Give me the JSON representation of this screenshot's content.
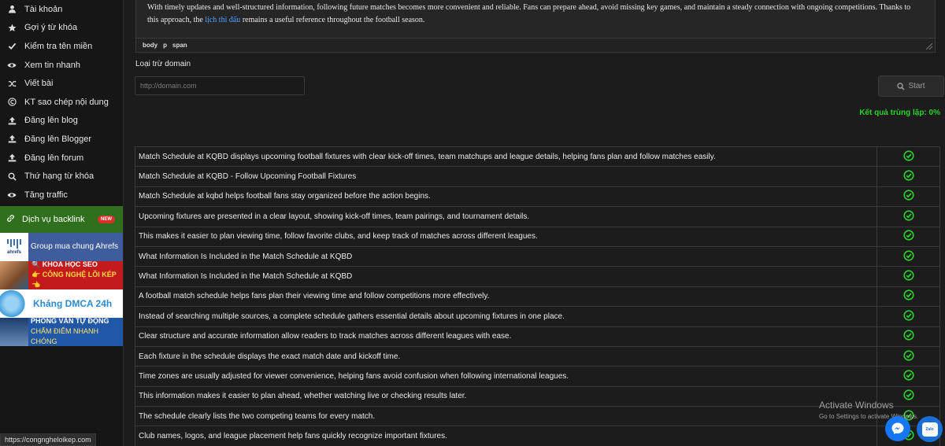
{
  "sidebar": {
    "items": [
      {
        "label": "Tài khoản",
        "icon": "user-icon"
      },
      {
        "label": "Gợi ý từ khóa",
        "icon": "star-icon"
      },
      {
        "label": "Kiểm tra tên miền",
        "icon": "check-icon"
      },
      {
        "label": "Xem tin nhanh",
        "icon": "eye-icon"
      },
      {
        "label": "Viết bài",
        "icon": "shuffle-icon"
      },
      {
        "label": "KT sao chép nội dung",
        "icon": "copyright-icon"
      },
      {
        "label": "Đăng lên blog",
        "icon": "upload-icon"
      },
      {
        "label": "Đăng lên Blogger",
        "icon": "upload-icon"
      },
      {
        "label": "Đăng lên forum",
        "icon": "upload-icon"
      },
      {
        "label": "Thứ hạng từ khóa",
        "icon": "search-icon"
      },
      {
        "label": "Tăng traffic",
        "icon": "eye-icon"
      }
    ],
    "backlink": {
      "label": "Dịch vụ backlink",
      "badge": "NEW"
    },
    "banners": {
      "ahrefs": {
        "logo": "ahrefs",
        "text": "Group mua chung Ahrefs"
      },
      "seo": {
        "line1": "🔍 KHÓA HỌC SEO",
        "line2": "👉 CÔNG NGHỆ LÕI KÉP 👈"
      },
      "dmca": {
        "text": "Kháng DMCA 24h"
      },
      "interview": {
        "line1": "PHỎNG VẤN TỰ ĐỘNG",
        "line2": "CHẤM ĐIỂM NHANH CHÓNG"
      }
    }
  },
  "status_url": "https://congngheloikep.com",
  "editor": {
    "text_before": "With timely updates and well-structured information, following future matches becomes more convenient and reliable. Fans can prepare ahead, avoid missing key games, and maintain a steady connection with ongoing competitions. Thanks to this approach, the ",
    "link_text": "lịch thi đấu",
    "text_after": " remains a useful reference throughout the football season.",
    "path": [
      "body",
      "p",
      "span"
    ]
  },
  "exclude": {
    "label": "Loại trừ domain",
    "placeholder": "http://domain.com"
  },
  "start_button": "Start",
  "result_text": "Kết quả trùng lặp: 0%",
  "colors": {
    "success": "#2bd12b",
    "link": "#4da3ff",
    "backlink_bg": "#2f6f1d"
  },
  "rows": [
    {
      "text": "Match Schedule at KQBD displays upcoming football fixtures with clear kick-off times, team matchups and league details, helping fans plan and follow matches easily.",
      "status": "ok"
    },
    {
      "text": "Match Schedule at KQBD - Follow Upcoming Football Fixtures",
      "status": "ok"
    },
    {
      "text": "Match Schedule at kqbd helps football fans stay organized before the action begins.",
      "status": "ok"
    },
    {
      "text": "Upcoming fixtures are presented in a clear layout, showing kick-off times, team pairings, and tournament details.",
      "status": "ok"
    },
    {
      "text": "This makes it easier to plan viewing time, follow favorite clubs, and keep track of matches across different leagues.",
      "status": "ok"
    },
    {
      "text": "What Information Is Included in the Match Schedule at KQBD",
      "status": "ok"
    },
    {
      "text": "What Information Is Included in the Match Schedule at KQBD",
      "status": "ok"
    },
    {
      "text": "A football match schedule helps fans plan their viewing time and follow competitions more effectively.",
      "status": "ok"
    },
    {
      "text": "Instead of searching multiple sources, a complete schedule gathers essential details about upcoming fixtures in one place.",
      "status": "ok"
    },
    {
      "text": "Clear structure and accurate information allow readers to track matches across different leagues with ease.",
      "status": "ok"
    },
    {
      "text": "Each fixture in the schedule displays the exact match date and kickoff time.",
      "status": "ok"
    },
    {
      "text": "Time zones are usually adjusted for viewer convenience, helping fans avoid confusion when following international leagues.",
      "status": "ok"
    },
    {
      "text": "This information makes it easier to plan ahead, whether watching live or checking results later.",
      "status": "ok"
    },
    {
      "text": "The schedule clearly lists the two competing teams for every match.",
      "status": "ok"
    },
    {
      "text": "Club names, logos, and league placement help fans quickly recognize important fixtures.",
      "status": "ok"
    }
  ],
  "watermark": {
    "line1": "Activate Windows",
    "line2": "Go to Settings to activate Windows."
  },
  "floating": {
    "zalo_label": "Zalo"
  }
}
